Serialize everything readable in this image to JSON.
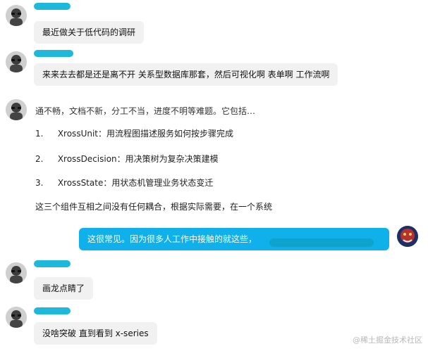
{
  "messages": {
    "m1": {
      "text": "最近做关于低代码的调研"
    },
    "m2": {
      "text": "来来去去都是还是离不开 关系型数据库那套，然后可视化啊 表单啊 工作流啊"
    },
    "quoted": {
      "partial_line": "通不畅，文档不新，分工不当，进度不明等难题。它包括…",
      "item1_num": "1.",
      "item1_text": "XrossUnit：用流程图描述服务如何按步骤完成",
      "item2_num": "2.",
      "item2_text": "XrossDecision：用决策树为复杂决策建模",
      "item3_num": "3.",
      "item3_text": "XrossState：用状态机管理业务状态变迁",
      "summary": "这三个组件互相之间没有任何耦合，根据实际需要，在一个系统"
    },
    "m3": {
      "text": "这很常见。因为很多人工作中接触的就这些，"
    },
    "m4": {
      "text": "画龙点睛了"
    },
    "m5": {
      "text": "没啥突破 直到看到 x-series"
    }
  },
  "watermark": {
    "text": "@稀土掘金技术社区"
  },
  "colors": {
    "left_bubble": "#f1f1f1",
    "right_bubble": "#10b1ea",
    "redaction": "#11b4d8"
  }
}
